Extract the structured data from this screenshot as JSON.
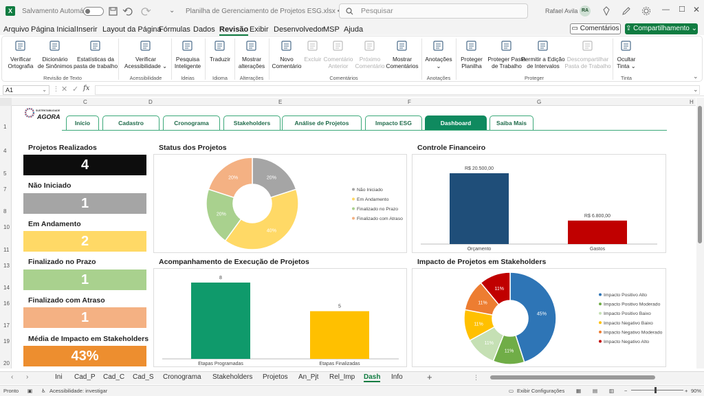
{
  "titlebar": {
    "autosave": "Salvamento Automático",
    "filename": "Planilha de Gerenciamento de Projetos ESG.xlsx • Salvo",
    "search_placeholder": "Pesquisar",
    "user": "Rafael Avila",
    "initials": "RA"
  },
  "menu": [
    "Arquivo",
    "Página Inicial",
    "Inserir",
    "Layout da Página",
    "Fórmulas",
    "Dados",
    "Revisão",
    "Exibir",
    "Desenvolvedor",
    "MSP",
    "Ajuda"
  ],
  "menu_active": "Revisão",
  "actions": {
    "comments": "Comentários",
    "share": "Compartilhamento"
  },
  "ribbon": {
    "buttons": [
      {
        "id": "spell",
        "line1": "Verificar",
        "line2": "Ortografia",
        "x": 30,
        "dis": false,
        "icon": "abc"
      },
      {
        "id": "thes",
        "line1": "Dicionário",
        "line2": "de Sinônimos",
        "x": 80,
        "dis": false
      },
      {
        "id": "stats",
        "line1": "Estatísticas da",
        "line2": "pasta de trabalho",
        "x": 139,
        "dis": false
      },
      {
        "id": "acc",
        "line1": "Verificar",
        "line2": "Acessibilidade ⌄",
        "x": 212,
        "dis": false
      },
      {
        "id": "smart",
        "line1": "Pesquisa",
        "line2": "Inteligente",
        "x": 273,
        "dis": false
      },
      {
        "id": "trans",
        "line1": "Traduzir",
        "line2": "",
        "x": 320,
        "dis": false
      },
      {
        "id": "changes",
        "line1": "Mostrar",
        "line2": "alterações",
        "x": 366,
        "dis": false
      },
      {
        "id": "newc",
        "line1": "Novo",
        "line2": "Comentário",
        "x": 417,
        "dis": false
      },
      {
        "id": "delc",
        "line1": "Excluir",
        "line2": "",
        "x": 455,
        "dis": true
      },
      {
        "id": "prevc",
        "line1": "Comentário",
        "line2": "Anterior",
        "x": 492,
        "dis": true
      },
      {
        "id": "nextc",
        "line1": "Próximo",
        "line2": "Comentário",
        "x": 538,
        "dis": true
      },
      {
        "id": "showc",
        "line1": "Mostrar",
        "line2": "Comentários",
        "x": 585,
        "dis": false
      },
      {
        "id": "notes",
        "line1": "Anotações",
        "line2": "⌄",
        "x": 638,
        "dis": false
      },
      {
        "id": "protsheet",
        "line1": "Proteger",
        "line2": "Planilha",
        "x": 686,
        "dis": false
      },
      {
        "id": "protbook",
        "line1": "Proteger Pasta",
        "line2": "de Trabalho",
        "x": 737,
        "dis": false
      },
      {
        "id": "allow",
        "line1": "Permitir a Edição",
        "line2": "de Intervalos",
        "x": 790,
        "dis": false
      },
      {
        "id": "unshare",
        "line1": "Descompartilhar",
        "line2": "Pasta de Trabalho",
        "x": 855,
        "dis": true
      },
      {
        "id": "hideink",
        "line1": "Ocultar",
        "line2": "Tinta ⌄",
        "x": 911,
        "dis": false
      }
    ],
    "groups": [
      {
        "label": "Revisão de Texto",
        "x": 91
      },
      {
        "label": "Acessibilidade",
        "x": 212
      },
      {
        "label": "Ideias",
        "x": 273
      },
      {
        "label": "Idioma",
        "x": 320
      },
      {
        "label": "Alterações",
        "x": 366
      },
      {
        "label": "Comentários",
        "x": 500
      },
      {
        "label": "Anotações",
        "x": 638
      },
      {
        "label": "Proteger",
        "x": 777
      },
      {
        "label": "Tinta",
        "x": 911
      }
    ]
  },
  "formula": {
    "cell": "A1",
    "fx": "fx",
    "value": ""
  },
  "columns": [
    "C",
    "D",
    "E",
    "F",
    "G",
    "H"
  ],
  "rows": [
    "1",
    "4",
    "5",
    "7",
    "8",
    "10",
    "11",
    "13",
    "14",
    "16",
    "17",
    "19",
    "20"
  ],
  "logo": {
    "line1": "SUSTENTABILIDADE",
    "line2": "AGORA"
  },
  "nav_tabs": [
    "Início",
    "Cadastro",
    "Cronograma",
    "Stakeholders",
    "Análise de Projetos",
    "Impacto ESG",
    "Dashboard",
    "Saiba Mais"
  ],
  "nav_active": "Dashboard",
  "kpis": [
    {
      "label": "Projetos Realizados",
      "value": "4",
      "color": "#0d0d0d"
    },
    {
      "label": "Não Iniciado",
      "value": "1",
      "color": "#a5a5a5"
    },
    {
      "label": "Em Andamento",
      "value": "2",
      "color": "#ffd966"
    },
    {
      "label": "Finalizado no Prazo",
      "value": "1",
      "color": "#a9d18e"
    },
    {
      "label": "Finalizado com Atraso",
      "value": "1",
      "color": "#f4b183"
    },
    {
      "label": "Média de Impacto em Stakeholders",
      "value": "43%",
      "color": "#ed8e2f"
    }
  ],
  "chart_data": [
    {
      "type": "pie",
      "title": "Status dos Projetos",
      "categories": [
        "Não Iniciado",
        "Em Andamento",
        "Finalizado no Prazo",
        "Finalizado com Atraso"
      ],
      "values": [
        20,
        40,
        20,
        20
      ],
      "labels": [
        "20%",
        "40%",
        "20%",
        "20%"
      ],
      "colors": [
        "#a5a5a5",
        "#ffd966",
        "#a9d18e",
        "#f4b183"
      ],
      "legend": "right"
    },
    {
      "type": "bar",
      "title": "Controle Financeiro",
      "categories": [
        "Orçamento",
        "Gastos"
      ],
      "values": [
        20500,
        6800
      ],
      "labels": [
        "R$ 20.500,00",
        "R$ 6.800,00"
      ],
      "colors": [
        "#1f4e79",
        "#c00000"
      ],
      "ylim": [
        0,
        20500
      ]
    },
    {
      "type": "bar",
      "title": "Acompanhamento de Execução de Projetos",
      "categories": [
        "Etapas Programadas",
        "Etapas Finalizadas"
      ],
      "values": [
        8,
        5
      ],
      "labels": [
        "8",
        "5"
      ],
      "colors": [
        "#0f9a6b",
        "#ffc000"
      ],
      "ylim": [
        0,
        8
      ]
    },
    {
      "type": "pie",
      "title": "Impacto de Projetos em Stakeholders",
      "categories": [
        "Impacto Positivo Alto",
        "Impacto Positivo Moderado",
        "Impacto Positivo Baixo",
        "Impacto Negativo Baixo",
        "Impacto Negativo Moderado",
        "Impacto Negativo Alto"
      ],
      "values": [
        45,
        11,
        11,
        11,
        11,
        11
      ],
      "labels": [
        "45%",
        "11%",
        "11%",
        "11%",
        "11%",
        "11%"
      ],
      "colors": [
        "#2e75b6",
        "#70ad47",
        "#c5e0b4",
        "#ffc000",
        "#ed7d31",
        "#c00000"
      ],
      "legend": "right"
    }
  ],
  "sheet_tabs": [
    "Ini",
    "Cad_P",
    "Cad_C",
    "Cad_S",
    "Cronograma",
    "Stakeholders",
    "Projetos",
    "An_Pjt",
    "Rel_Imp",
    "Dash",
    "Info"
  ],
  "sheet_active": "Dash",
  "status": {
    "ready": "Pronto",
    "accessibility": "Acessibilidade: investigar",
    "display": "Exibir Configurações",
    "zoom": "90%"
  }
}
